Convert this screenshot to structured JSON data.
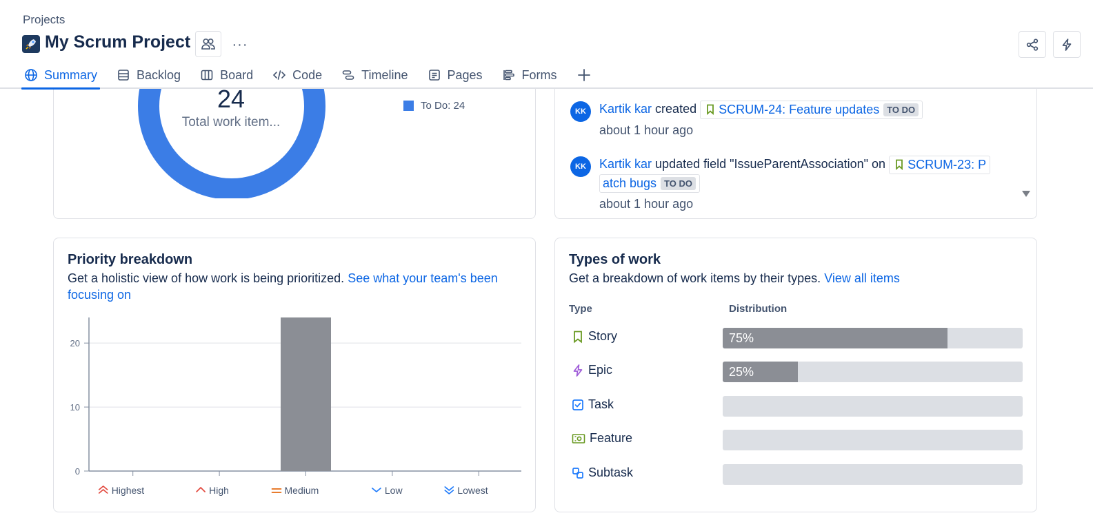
{
  "header": {
    "breadcrumb": "Projects",
    "project_title": "My Scrum Project",
    "more_label": "···"
  },
  "tabs": [
    {
      "label": "Summary",
      "icon": "globe-icon",
      "active": true
    },
    {
      "label": "Backlog",
      "icon": "backlog-icon"
    },
    {
      "label": "Board",
      "icon": "board-icon"
    },
    {
      "label": "Code",
      "icon": "code-icon"
    },
    {
      "label": "Timeline",
      "icon": "timeline-icon"
    },
    {
      "label": "Pages",
      "icon": "pages-icon"
    },
    {
      "label": "Forms",
      "icon": "forms-icon"
    }
  ],
  "status_overview": {
    "total": "24",
    "total_label": "Total work item...",
    "legend": "To Do: 24",
    "donut_color": "#3b7de6"
  },
  "activity": [
    {
      "avatar": "KK",
      "user": "Kartik kar",
      "action": "created",
      "issue": "SCRUM-24: Feature updates",
      "status": "TO DO",
      "time": "about 1 hour ago"
    },
    {
      "avatar": "KK",
      "user": "Kartik kar",
      "action": "updated field \"IssueParentAssociation\" on",
      "issue_line1": "SCRUM-23: P",
      "issue_line2": "atch bugs",
      "status": "TO DO",
      "time": "about 1 hour ago"
    }
  ],
  "priority": {
    "title": "Priority breakdown",
    "desc": "Get a holistic view of how work is being prioritized.",
    "link": "See what your team's been focusing on"
  },
  "chart_data": {
    "type": "bar",
    "categories": [
      "Highest",
      "High",
      "Medium",
      "Low",
      "Lowest"
    ],
    "values": [
      0,
      0,
      24,
      0,
      0
    ],
    "ylim": [
      0,
      24
    ],
    "yticks": [
      0,
      10,
      20
    ],
    "grid": true,
    "bar_color": "#8b8e95",
    "category_icons": [
      "highest-priority-icon",
      "high-priority-icon",
      "medium-priority-icon",
      "low-priority-icon",
      "lowest-priority-icon"
    ],
    "category_colors": [
      "#e2483d",
      "#e2483d",
      "#e56910",
      "#1d7afc",
      "#1d7afc"
    ]
  },
  "types": {
    "title": "Types of work",
    "desc": "Get a breakdown of work items by their types.",
    "link": "View all items",
    "col_type": "Type",
    "col_dist": "Distribution",
    "rows": [
      {
        "name": "Story",
        "icon": "story-icon",
        "percent": 75,
        "label": "75%"
      },
      {
        "name": "Epic",
        "icon": "epic-icon",
        "percent": 25,
        "label": "25%"
      },
      {
        "name": "Task",
        "icon": "task-icon",
        "percent": 0,
        "label": ""
      },
      {
        "name": "Feature",
        "icon": "feature-icon",
        "percent": 0,
        "label": ""
      },
      {
        "name": "Subtask",
        "icon": "subtask-icon",
        "percent": 0,
        "label": ""
      }
    ]
  }
}
